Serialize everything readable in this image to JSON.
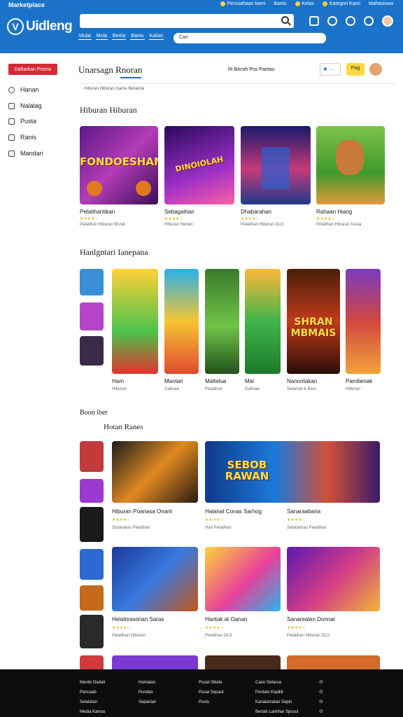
{
  "topbar": {
    "site_name": "Marketplace",
    "links": [
      "Perusahaan kami",
      "Bantu",
      "Kelas",
      "Kategori Kami",
      "Mahasiswa"
    ],
    "logo_text": "Uidleng",
    "search_placeholder": "",
    "nav_tabs": [
      "Mulai",
      "Mula",
      "Berita",
      "Bantu",
      "Kalian"
    ],
    "subsearch_placeholder": "Cari"
  },
  "sidebar": {
    "promo": "Daftarkan Promo",
    "items": [
      "Hanan",
      "Nalalag",
      "Pusta",
      "Ranis",
      "Mandari"
    ]
  },
  "title_row": {
    "title": "Unarsagn Rnoran",
    "meta": "Unarsagn Rnoran",
    "filters": "Ri Bersih Pos   Pantau",
    "share_label": "···",
    "buy_label": "Pag"
  },
  "breadcrumb": "Hiburan  Hiburan  Game  Beranda",
  "sections": [
    {
      "title": "Hiburan Hiburan",
      "cards": [
        {
          "name": "Pelatihantikan",
          "art": "FONDOESHAN",
          "stars": "★★★★☆",
          "meta": "Pelatihan Hiburan Musik"
        },
        {
          "name": "Sebagaihan",
          "art": "DINOIOLAH",
          "stars": "★★★★☆",
          "meta": "Hiburan Hebeti"
        },
        {
          "name": "Dhabarahan",
          "art": "",
          "stars": "★★★★☆",
          "meta": "Pelatihan Hiburan DLD"
        },
        {
          "name": "Rahaan Hiang",
          "art": "",
          "stars": "★★★★☆",
          "meta": "Pelatihan Hiburan Kesia"
        }
      ]
    },
    {
      "title": "Hanlgntari Ianepana",
      "cards": [
        {
          "name": "Ham",
          "art": "",
          "meta": "Hiburan"
        },
        {
          "name": "Mantari",
          "art": "",
          "meta": "Galinaa"
        },
        {
          "name": "Maltelua",
          "art": "",
          "meta": "Pelatihan"
        },
        {
          "name": "Mal",
          "art": "",
          "meta": "Galinaa"
        },
        {
          "name": "Nanontakan",
          "art": "SHRAN MBMAIS",
          "meta": "Selamat & Baru"
        },
        {
          "name": "Pambenak",
          "art": "",
          "meta": "Hiburan"
        }
      ]
    },
    {
      "title": "Hotan Ranes",
      "kicker": "Boon iber",
      "cards": [
        {
          "name": "Hiburan Poanasa Onant",
          "art": "",
          "stars": "★★★★☆",
          "meta": "Siulanalan Pelatihan"
        },
        {
          "name": "Halanat Conas Sarhog",
          "art": "SEBOB RAWAN",
          "stars": "★★★★☆",
          "meta": "Hari Pelatihan"
        },
        {
          "name": "Sanaraabana",
          "art": "",
          "stars": "★★★★☆",
          "meta": "Selatiamau Pelatihan"
        },
        {
          "name": "Helatiirasonan Saras",
          "art": "",
          "stars": "★★★★☆",
          "meta": "Pelatihan Hiburan"
        },
        {
          "name": "Hantak at Oanan",
          "art": "",
          "stars": "★★★★☆",
          "meta": "Pelatihan OLS"
        },
        {
          "name": "Sanarealan Donnal",
          "art": "",
          "stars": "★★★★☆",
          "meta": "Pelatihan Hiburan DLS"
        }
      ]
    }
  ],
  "footer": {
    "col1": [
      "Merde Oadati",
      "Pancaab",
      "Selalatan",
      "Media Kamas"
    ],
    "col2": [
      "Hamalan",
      "Pundan",
      "Sepanian"
    ],
    "col3": [
      "Pusat Sikela",
      "Pusal Sepaut",
      "Pusts"
    ],
    "col4": [
      "Cano Setarua",
      "Ponlato Kopiliti",
      "Kanalamatan Sapin",
      "Bertah Lanhhar Spusul"
    ],
    "social": [
      "⊙",
      "⊙",
      "⊙",
      "⊙"
    ]
  },
  "colors": {
    "brand": "#1a73c9",
    "promo": "#d42a35",
    "accent": "#ffd83d"
  }
}
